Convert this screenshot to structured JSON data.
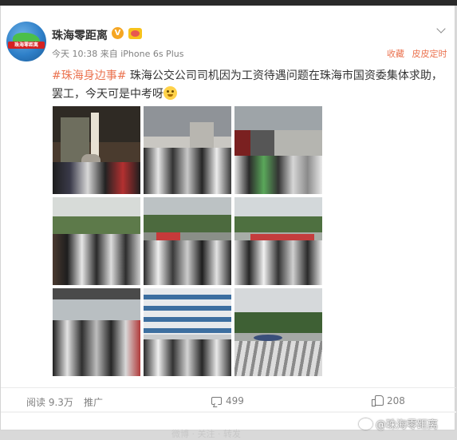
{
  "post": {
    "username": "珠海零距离",
    "verified_badge": "V",
    "avatar_banner": "珠海零距离",
    "time": "今天 10:38",
    "source_prefix": "来自",
    "source": "iPhone 6s Plus",
    "actions": {
      "favorite": "收藏",
      "timer": "皮皮定时"
    },
    "hashtag": "#珠海身边事#",
    "text": " 珠海公交公司司机因为工资待遇问题在珠海市国资委集体求助，罢工，今天可是中考呀",
    "emoji": "confused-face-emoji",
    "images_count": 9
  },
  "stats": {
    "reads": "阅读 9.3万",
    "promote": "推广",
    "comments": "499",
    "likes": "208"
  },
  "watermark": "@珠海零距离",
  "footer_faint": "微博 · 关注 · 转发",
  "colors": {
    "accent": "#eb7350",
    "text": "#333333",
    "meta": "#808080",
    "verified": "#f5a623"
  }
}
